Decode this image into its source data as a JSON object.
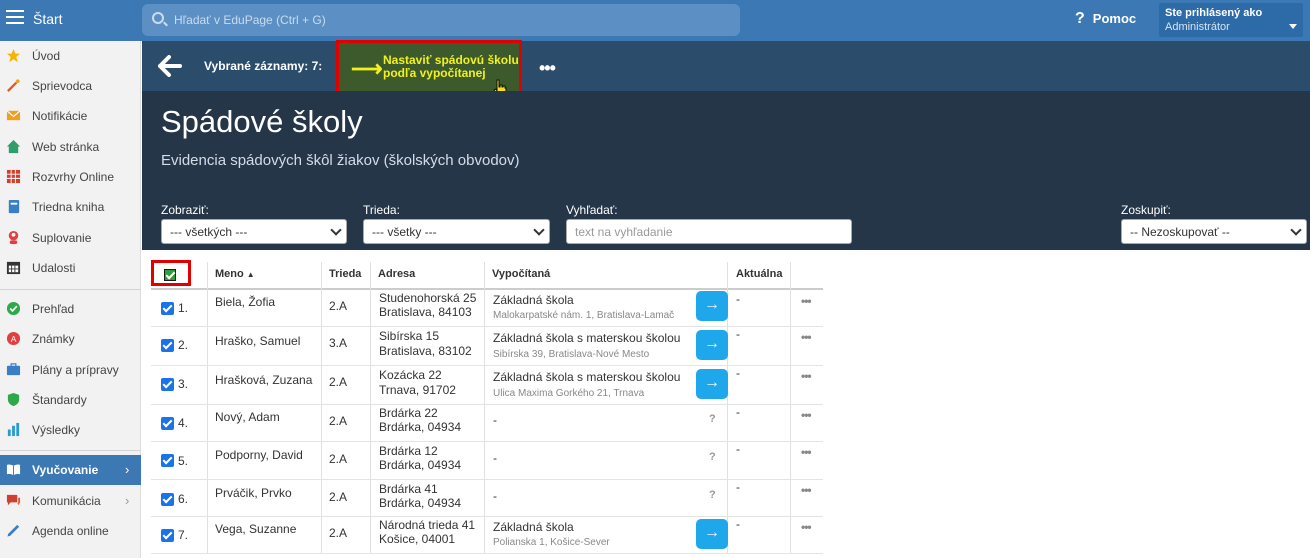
{
  "topbar": {
    "title": "Štart",
    "search_placeholder": "Hľadať v EduPage (Ctrl + G)",
    "help_label": "Pomoc",
    "user_line1": "Ste prihlásený ako",
    "user_line2": "Administrátor"
  },
  "sidebar": {
    "items": [
      {
        "label": "Úvod",
        "icon": "star-icon",
        "color": "#f5b400"
      },
      {
        "label": "Sprievodca",
        "icon": "wand-icon",
        "color": "#e05a2a"
      },
      {
        "label": "Notifikácie",
        "icon": "envelope-icon",
        "color": "#f0a020"
      },
      {
        "label": "Web stránka",
        "icon": "house-icon",
        "color": "#2e9e6a"
      },
      {
        "label": "Rozvrhy Online",
        "icon": "grid-icon",
        "color": "#d04030"
      },
      {
        "label": "Triedna kniha",
        "icon": "book-icon",
        "color": "#3a7ec8"
      },
      {
        "label": "Suplovanie",
        "icon": "person-icon",
        "color": "#e04040"
      },
      {
        "label": "Udalosti",
        "icon": "calendar-icon",
        "color": "#333333"
      },
      {
        "label": "Prehľad",
        "icon": "check-circle-icon",
        "color": "#2ea84a"
      },
      {
        "label": "Známky",
        "icon": "grade-icon",
        "color": "#e04040"
      },
      {
        "label": "Plány a prípravy",
        "icon": "briefcase-icon",
        "color": "#3a7ec8"
      },
      {
        "label": "Štandardy",
        "icon": "shield-icon",
        "color": "#2ea84a"
      },
      {
        "label": "Výsledky",
        "icon": "bar-chart-icon",
        "color": "#2a9ad0"
      },
      {
        "label": "Vyučovanie",
        "icon": "open-book-icon",
        "color": "#ffffff"
      },
      {
        "label": "Komunikácia",
        "icon": "chat-icon",
        "color": "#d04030"
      },
      {
        "label": "Agenda online",
        "icon": "pen-icon",
        "color": "#3a7ec8"
      }
    ]
  },
  "actionbar": {
    "selected_label": "Vybrané záznamy: 7:",
    "action_label": "Nastaviť spádovú školu podľa vypočítanej",
    "more_label": "•••"
  },
  "header": {
    "title": "Spádové školy",
    "subtitle": "Evidencia spádových škôl žiakov (školských obvodov)"
  },
  "filters": {
    "show_label": "Zobraziť:",
    "show_value": "--- všetkých ---",
    "class_label": "Trieda:",
    "class_value": "--- všetky ---",
    "search_label": "Vyhľadať:",
    "search_placeholder": "text na vyhľadanie",
    "group_label": "Zoskupiť:",
    "group_value": "-- Nezoskupovať --"
  },
  "table": {
    "columns": {
      "name": "Meno",
      "class": "Trieda",
      "address": "Adresa",
      "computed": "Vypočítaná",
      "current": "Aktuálna"
    },
    "rows": [
      {
        "num": "1.",
        "name": "Biela, Žofia",
        "class": "2.A",
        "addr1": "Studenohorská 25",
        "addr2": "Bratislava, 84103",
        "school": "Základná škola",
        "school_addr": "Malokarpatské nám. 1, Bratislava-Lamač",
        "action": "→",
        "current": "-"
      },
      {
        "num": "2.",
        "name": "Hraško, Samuel",
        "class": "3.A",
        "addr1": "Sibírska 15",
        "addr2": "Bratislava, 83102",
        "school": "Základná škola s materskou školou",
        "school_addr": "Sibírska 39, Bratislava-Nové Mesto",
        "action": "→",
        "current": "-"
      },
      {
        "num": "3.",
        "name": "Hrašková, Zuzana",
        "class": "2.A",
        "addr1": "Kozácka 22",
        "addr2": "Trnava, 91702",
        "school": "Základná škola s materskou školou",
        "school_addr": "Ulica Maxima Gorkého 21, Trnava",
        "action": "→",
        "current": "-"
      },
      {
        "num": "4.",
        "name": "Nový, Adam",
        "class": "2.A",
        "addr1": "Brdárka 22",
        "addr2": "Brdárka, 04934",
        "school": "-",
        "school_addr": "",
        "action": "?",
        "current": "-"
      },
      {
        "num": "5.",
        "name": "Podporny, David",
        "class": "2.A",
        "addr1": "Brdárka 12",
        "addr2": "Brdárka, 04934",
        "school": "-",
        "school_addr": "",
        "action": "?",
        "current": "-"
      },
      {
        "num": "6.",
        "name": "Prváčik, Prvko",
        "class": "2.A",
        "addr1": "Brdárka 41",
        "addr2": "Brdárka, 04934",
        "school": "-",
        "school_addr": "",
        "action": "?",
        "current": "-"
      },
      {
        "num": "7.",
        "name": "Vega, Suzanne",
        "class": "2.A",
        "addr1": "Národná trieda 41",
        "addr2": "Košice, 04001",
        "school": "Základná škola",
        "school_addr": "Polianska 1, Košice-Sever",
        "action": "→",
        "current": "-"
      }
    ]
  },
  "colors": {
    "topbar": "#3c78b4",
    "actionbar": "#2c4c6c",
    "header": "#263649",
    "highlight": "#e00000",
    "action_text": "#f2f21a",
    "go_button": "#1ea7ea"
  }
}
